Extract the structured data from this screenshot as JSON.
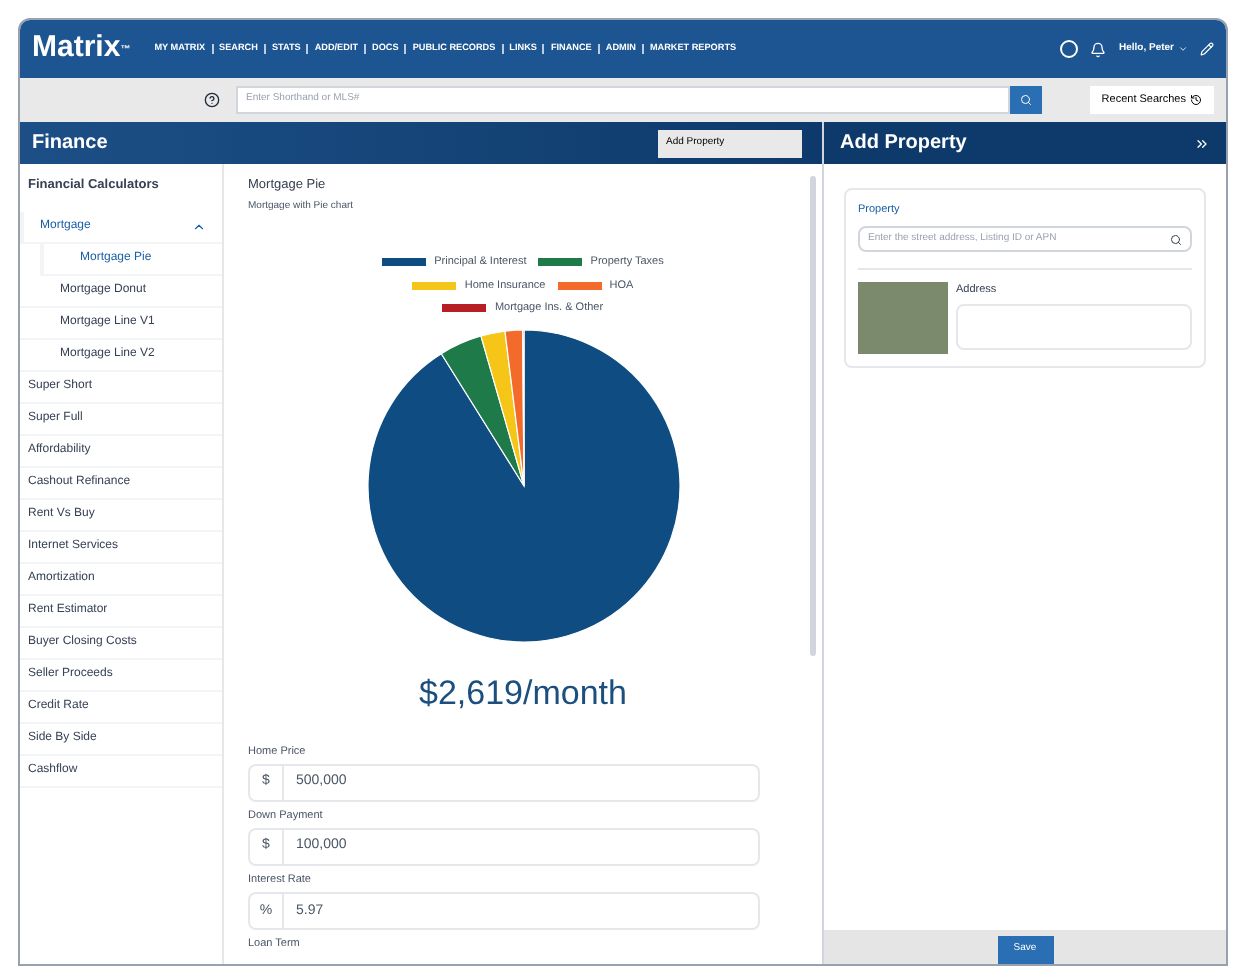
{
  "topbar": {
    "logo": "Matrix",
    "logo_mark": "™",
    "nav": [
      "MY MATRIX",
      "SEARCH",
      "STATS",
      "ADD/EDIT",
      "DOCS",
      "PUBLIC RECORDS",
      "LINKS",
      "FINANCE",
      "ADMIN",
      "MARKET REPORTS"
    ],
    "user": "Hello, Peter"
  },
  "searchbar": {
    "placeholder": "Enter Shorthand or MLS#",
    "recent": "Recent Searches"
  },
  "finance": {
    "title": "Finance",
    "add_button": "Add Property"
  },
  "sidebar": {
    "heading": "Financial Calculators",
    "items": [
      {
        "label": "Mortgage",
        "selected": true,
        "expanded": true,
        "children": [
          {
            "label": "Mortgage Pie",
            "selected": true
          },
          {
            "label": "Mortgage Donut",
            "selected": false
          },
          {
            "label": "Mortgage Line V1",
            "selected": false
          },
          {
            "label": "Mortgage Line V2",
            "selected": false
          }
        ]
      },
      {
        "label": "Super Short",
        "selected": false
      },
      {
        "label": "Super Full",
        "selected": false
      },
      {
        "label": "Affordability",
        "selected": false
      },
      {
        "label": "Cashout Refinance",
        "selected": false
      },
      {
        "label": "Rent Vs Buy",
        "selected": false
      },
      {
        "label": "Internet Services",
        "selected": false
      },
      {
        "label": "Amortization",
        "selected": false
      },
      {
        "label": "Rent Estimator",
        "selected": false
      },
      {
        "label": "Buyer Closing Costs",
        "selected": false
      },
      {
        "label": "Seller Proceeds",
        "selected": false
      },
      {
        "label": "Credit Rate",
        "selected": false
      },
      {
        "label": "Side By Side",
        "selected": false
      },
      {
        "label": "Cashflow",
        "selected": false
      }
    ]
  },
  "calculator": {
    "title": "Mortgage Pie",
    "subtitle": "Mortgage with Pie chart",
    "legend": [
      {
        "label": "Principal & Interest",
        "color": "#0f4c81"
      },
      {
        "label": "Property Taxes",
        "color": "#1f7a4a"
      },
      {
        "label": "Home Insurance",
        "color": "#f5c518"
      },
      {
        "label": "HOA",
        "color": "#f26b2a"
      },
      {
        "label": "Mortgage Ins. & Other",
        "color": "#b81f24"
      }
    ],
    "total": "$2,619/month",
    "fields": [
      {
        "label": "Home Price",
        "prefix": "$",
        "value": "500,000"
      },
      {
        "label": "Down Payment",
        "prefix": "$",
        "value": "100,000"
      },
      {
        "label": "Interest Rate",
        "prefix": "%",
        "value": "5.97"
      }
    ],
    "next_label": "Loan Term"
  },
  "add_property": {
    "title": "Add Property",
    "property_label": "Property",
    "placeholder": "Enter the street address, Listing ID or APN",
    "address_label": "Address",
    "save": "Save"
  }
}
